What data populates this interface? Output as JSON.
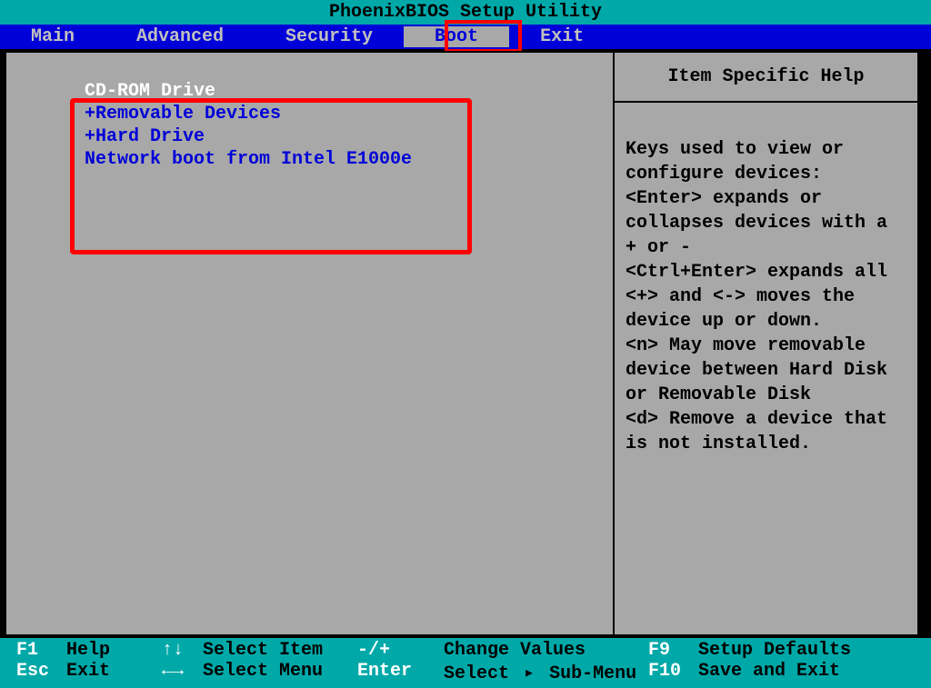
{
  "title": "PhoenixBIOS Setup Utility",
  "menu": {
    "items": [
      "Main",
      "Advanced",
      "Security",
      "Boot",
      "Exit"
    ],
    "active": 3
  },
  "boot_devices": [
    {
      "label": "CD-ROM Drive",
      "prefix": " ",
      "selected": true
    },
    {
      "label": "Removable Devices",
      "prefix": "+",
      "selected": false
    },
    {
      "label": "Hard Drive",
      "prefix": "+",
      "selected": false
    },
    {
      "label": "Network boot from Intel E1000e",
      "prefix": " ",
      "selected": false
    }
  ],
  "help": {
    "title": "Item Specific Help",
    "content": "Keys used to view or configure devices:\n<Enter> expands or collapses devices with a + or -\n<Ctrl+Enter> expands all\n<+> and <-> moves the device up or down.\n<n> May move removable device between Hard Disk or Removable Disk\n<d> Remove a device that is not installed."
  },
  "footer": {
    "row1": {
      "key1": "F1",
      "label1": "Help",
      "arrows": "↑↓",
      "desc1": "Select Item",
      "sym": "-/+",
      "action": "Change Values",
      "key2": "F9",
      "label2": "Setup Defaults"
    },
    "row2": {
      "key1": "Esc",
      "label1": "Exit",
      "arrows": "←→",
      "desc1": "Select Menu",
      "sym": "Enter",
      "action_pre": "Select",
      "action_post": "Sub-Menu",
      "key2": "F10",
      "label2": "Save and Exit"
    }
  }
}
